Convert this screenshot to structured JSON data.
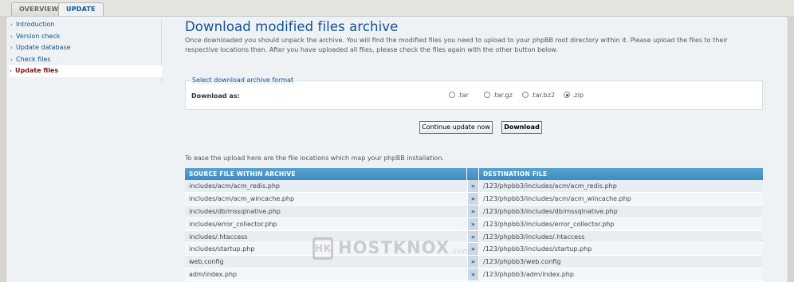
{
  "tabs": [
    {
      "label": "OVERVIEW"
    },
    {
      "label": "UPDATE"
    }
  ],
  "menu": {
    "items": [
      {
        "label": "Introduction"
      },
      {
        "label": "Version check"
      },
      {
        "label": "Update database"
      },
      {
        "label": "Check files"
      },
      {
        "label": "Update files"
      }
    ]
  },
  "main": {
    "title": "Download modified files archive",
    "description": "Once downloaded you should unpack the archive. You will find the modified files you need to upload to your phpBB root directory within it. Please upload the files to their respective locations then. After you have uploaded all files, please check the files again with the other button below.",
    "format": {
      "legend": "Select download archive format",
      "label": "Download as:",
      "options": [
        ".tar",
        ".tar.gz",
        ".tar.bz2",
        ".zip"
      ],
      "selected": ".zip"
    },
    "buttons": {
      "continue": "Continue update now",
      "download": "Download"
    },
    "ease_text": "To ease the upload here are the file locations which map your phpBB installation.",
    "table": {
      "headers": [
        "SOURCE FILE WITHIN ARCHIVE",
        "DESTINATION FILE"
      ],
      "separator": "»",
      "rows": [
        [
          "includes/acm/acm_redis.php",
          "/123/phpbb3/includes/acm/acm_redis.php"
        ],
        [
          "includes/acm/acm_wincache.php",
          "/123/phpbb3/includes/acm/acm_wincache.php"
        ],
        [
          "includes/db/mssqlnative.php",
          "/123/phpbb3/includes/db/mssqlnative.php"
        ],
        [
          "includes/error_collector.php",
          "/123/phpbb3/includes/error_collector.php"
        ],
        [
          "includes/.htaccess",
          "/123/phpbb3/includes/.htaccess"
        ],
        [
          "includes/startup.php",
          "/123/phpbb3/includes/startup.php"
        ],
        [
          "web.config",
          "/123/phpbb3/web.config"
        ],
        [
          "adm/index.php",
          "/123/phpbb3/adm/index.php"
        ]
      ]
    }
  },
  "watermark": {
    "text": "HOSTKNOX",
    "suffix": ".com",
    "logo": "HK"
  }
}
